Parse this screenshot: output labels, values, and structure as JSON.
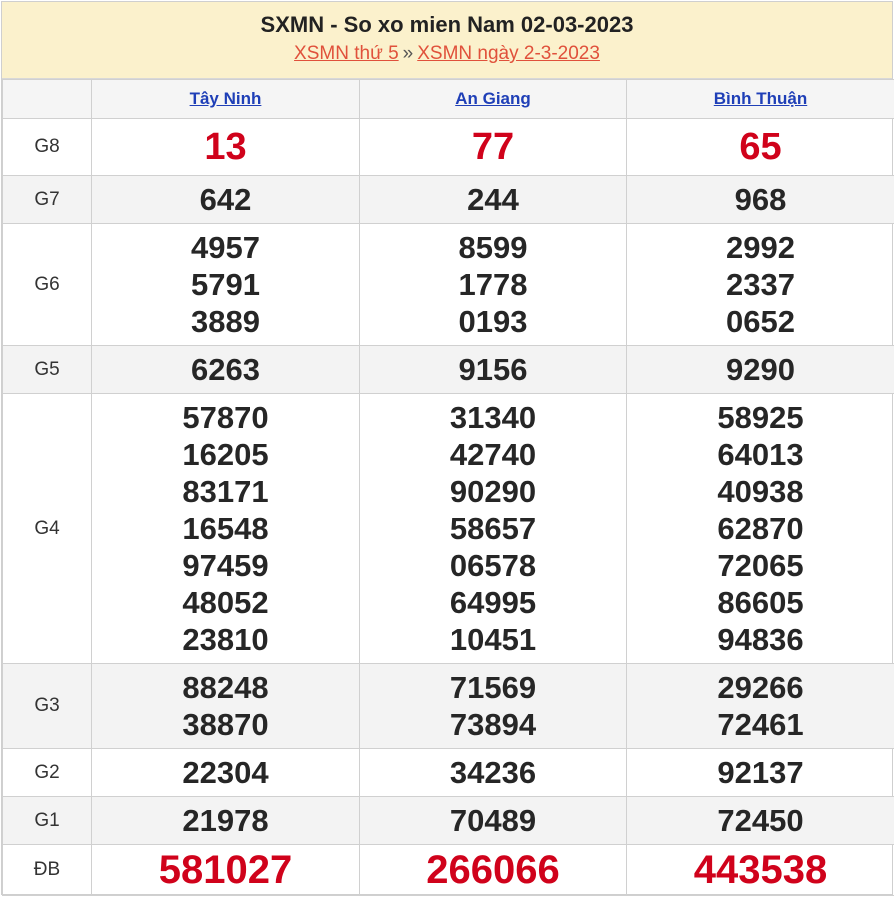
{
  "header": {
    "title": "SXMN - So xo mien Nam 02-03-2023",
    "link1": "XSMN thứ 5",
    "separator": "»",
    "link2": "XSMN ngày 2-3-2023"
  },
  "provinces": [
    "Tây Ninh",
    "An Giang",
    "Bình Thuận"
  ],
  "rows": [
    {
      "prize": "G8",
      "values": [
        [
          "13"
        ],
        [
          "77"
        ],
        [
          "65"
        ]
      ]
    },
    {
      "prize": "G7",
      "values": [
        [
          "642"
        ],
        [
          "244"
        ],
        [
          "968"
        ]
      ]
    },
    {
      "prize": "G6",
      "values": [
        [
          "4957",
          "5791",
          "3889"
        ],
        [
          "8599",
          "1778",
          "0193"
        ],
        [
          "2992",
          "2337",
          "0652"
        ]
      ]
    },
    {
      "prize": "G5",
      "values": [
        [
          "6263"
        ],
        [
          "9156"
        ],
        [
          "9290"
        ]
      ]
    },
    {
      "prize": "G4",
      "values": [
        [
          "57870",
          "16205",
          "83171",
          "16548",
          "97459",
          "48052",
          "23810"
        ],
        [
          "31340",
          "42740",
          "90290",
          "58657",
          "06578",
          "64995",
          "10451"
        ],
        [
          "58925",
          "64013",
          "40938",
          "62870",
          "72065",
          "86605",
          "94836"
        ]
      ]
    },
    {
      "prize": "G3",
      "values": [
        [
          "88248",
          "38870"
        ],
        [
          "71569",
          "73894"
        ],
        [
          "29266",
          "72461"
        ]
      ]
    },
    {
      "prize": "G2",
      "values": [
        [
          "22304"
        ],
        [
          "34236"
        ],
        [
          "92137"
        ]
      ]
    },
    {
      "prize": "G1",
      "values": [
        [
          "21978"
        ],
        [
          "70489"
        ],
        [
          "72450"
        ]
      ]
    },
    {
      "prize": "ĐB",
      "values": [
        [
          "581027"
        ],
        [
          "266066"
        ],
        [
          "443538"
        ]
      ]
    }
  ],
  "colors": {
    "header_bg": "#fbf1cc",
    "link": "#e0513b",
    "province_link": "#1f3fb7",
    "highlight": "#d0021b"
  }
}
